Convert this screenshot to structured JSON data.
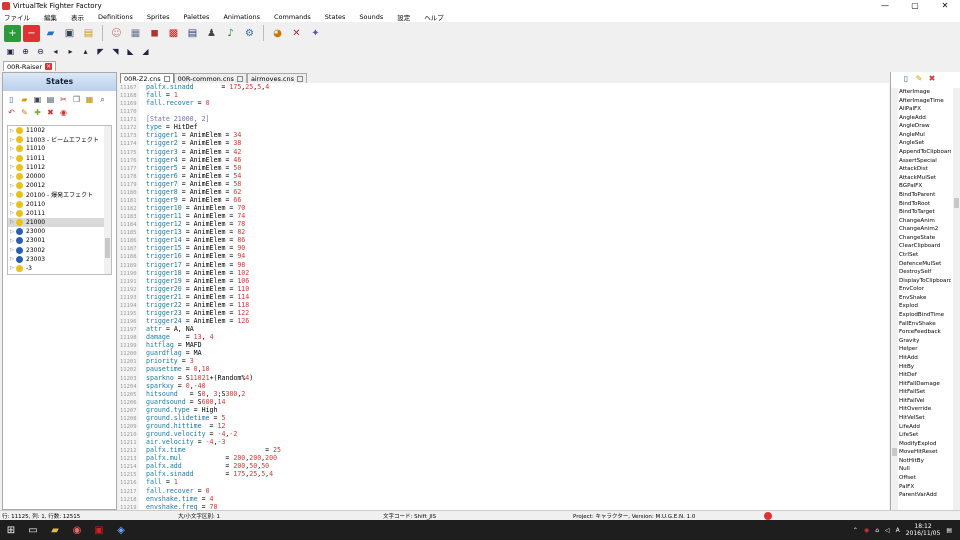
{
  "window": {
    "title": "VirtualTek Fighter Factory",
    "controls": [
      "—",
      "▢",
      "✕"
    ]
  },
  "menu": [
    "ファイル",
    "編集",
    "表示",
    "Definitions",
    "Sprites",
    "Palettes",
    "Animations",
    "Commands",
    "States",
    "Sounds",
    "設定",
    "ヘルプ"
  ],
  "doc_tab": {
    "label": "00R-Raiser"
  },
  "file_tabs": [
    {
      "label": "00R-Z2.cns"
    },
    {
      "label": "00R-common.cns"
    },
    {
      "label": "airmoves.cns"
    }
  ],
  "states_panel": {
    "title": "States",
    "tree": [
      {
        "label": "11002",
        "color": "yellow"
      },
      {
        "label": "11003 - ビームエフェクト",
        "color": "yellow"
      },
      {
        "label": "11010",
        "color": "yellow"
      },
      {
        "label": "11011",
        "color": "yellow"
      },
      {
        "label": "11012",
        "color": "yellow"
      },
      {
        "label": "20000",
        "color": "yellow"
      },
      {
        "label": "20012",
        "color": "yellow"
      },
      {
        "label": "20100 - 爆発エフェクト",
        "color": "yellow"
      },
      {
        "label": "20110",
        "color": "yellow"
      },
      {
        "label": "20111",
        "color": "yellow"
      },
      {
        "label": "21000",
        "color": "yellow",
        "selected": true
      },
      {
        "label": "23000",
        "color": "blue"
      },
      {
        "label": "23001",
        "color": "blue"
      },
      {
        "label": "23002",
        "color": "blue"
      },
      {
        "label": "23003",
        "color": "blue"
      },
      {
        "label": "-3",
        "color": "yellow"
      }
    ]
  },
  "code": {
    "lines": [
      {
        "n": "11167",
        "t": "palfx.sinadd       = 175,25,5,4"
      },
      {
        "n": "11168",
        "t": "fall = 1"
      },
      {
        "n": "11169",
        "t": "fall.recover = 0"
      },
      {
        "n": "11170",
        "t": ""
      },
      {
        "n": "11171",
        "t": "[State 21000, 2]"
      },
      {
        "n": "11172",
        "t": "type = HitDef"
      },
      {
        "n": "11173",
        "t": "trigger1 = AnimElem = 34"
      },
      {
        "n": "11174",
        "t": "trigger2 = AnimElem = 38"
      },
      {
        "n": "11175",
        "t": "trigger3 = AnimElem = 42"
      },
      {
        "n": "11176",
        "t": "trigger4 = AnimElem = 46"
      },
      {
        "n": "11177",
        "t": "trigger5 = AnimElem = 50"
      },
      {
        "n": "11178",
        "t": "trigger6 = AnimElem = 54"
      },
      {
        "n": "11179",
        "t": "trigger7 = AnimElem = 58"
      },
      {
        "n": "11180",
        "t": "trigger8 = AnimElem = 62"
      },
      {
        "n": "11181",
        "t": "trigger9 = AnimElem = 66"
      },
      {
        "n": "11182",
        "t": "trigger10 = AnimElem = 70"
      },
      {
        "n": "11183",
        "t": "trigger11 = AnimElem = 74"
      },
      {
        "n": "11184",
        "t": "trigger12 = AnimElem = 78"
      },
      {
        "n": "11185",
        "t": "trigger13 = AnimElem = 82"
      },
      {
        "n": "11186",
        "t": "trigger14 = AnimElem = 86"
      },
      {
        "n": "11187",
        "t": "trigger15 = AnimElem = 90"
      },
      {
        "n": "11188",
        "t": "trigger16 = AnimElem = 94"
      },
      {
        "n": "11189",
        "t": "trigger17 = AnimElem = 98"
      },
      {
        "n": "11190",
        "t": "trigger18 = AnimElem = 102"
      },
      {
        "n": "11191",
        "t": "trigger19 = AnimElem = 106"
      },
      {
        "n": "11192",
        "t": "trigger20 = AnimElem = 110"
      },
      {
        "n": "11193",
        "t": "trigger21 = AnimElem = 114"
      },
      {
        "n": "11194",
        "t": "trigger22 = AnimElem = 118"
      },
      {
        "n": "11195",
        "t": "trigger23 = AnimElem = 122"
      },
      {
        "n": "11196",
        "t": "trigger24 = AnimElem = 126"
      },
      {
        "n": "11197",
        "t": "attr = A, NA"
      },
      {
        "n": "11198",
        "t": "damage    = 13, 4"
      },
      {
        "n": "11199",
        "t": "hitflag = MAFD"
      },
      {
        "n": "11200",
        "t": "guardflag = MA"
      },
      {
        "n": "11201",
        "t": "priority = 3"
      },
      {
        "n": "11202",
        "t": "pausetime = 0,10"
      },
      {
        "n": "11203",
        "t": "sparkno = S11021+(Random%4)"
      },
      {
        "n": "11204",
        "t": "sparkxy = 0,-40"
      },
      {
        "n": "11205",
        "t": "hitsound   = S0, 3;S300,2"
      },
      {
        "n": "11206",
        "t": "guardsound = S600,14"
      },
      {
        "n": "11207",
        "t": "ground.type = High"
      },
      {
        "n": "11208",
        "t": "ground.slidetime = 5"
      },
      {
        "n": "11209",
        "t": "ground.hittime  = 12"
      },
      {
        "n": "11210",
        "t": "ground.velocity = -4,-2"
      },
      {
        "n": "11211",
        "t": "air.velocity = -4,-3"
      },
      {
        "n": "11212",
        "t": "palfx.time                    = 25"
      },
      {
        "n": "11213",
        "t": "palfx.mul           = 200,200,200"
      },
      {
        "n": "11214",
        "t": "palfx.add           = 200,50,50"
      },
      {
        "n": "11215",
        "t": "palfx.sinadd        = 175,25,5,4"
      },
      {
        "n": "11216",
        "t": "fall = 1"
      },
      {
        "n": "11217",
        "t": "fall.recover = 0"
      },
      {
        "n": "11218",
        "t": "envshake.time = 4"
      },
      {
        "n": "11219",
        "t": "envshake.freq = 70"
      }
    ]
  },
  "sctrl_list": [
    "AfterImage",
    "AfterImageTime",
    "AllPalFX",
    "AngleAdd",
    "AngleDraw",
    "AngleMul",
    "AngleSet",
    "AppendToClipboard",
    "AssertSpecial",
    "AttackDist",
    "AttackMulSet",
    "BGPalFX",
    "BindToParent",
    "BindToRoot",
    "BindToTarget",
    "ChangeAnim",
    "ChangeAnim2",
    "ChangeState",
    "ClearClipboard",
    "CtrlSet",
    "DefenceMulSet",
    "DestroySelf",
    "DisplayToClipboard",
    "EnvColor",
    "EnvShake",
    "Explod",
    "ExplodBindTime",
    "FallEnvShake",
    "ForceFeedback",
    "Gravity",
    "Helper",
    "HitAdd",
    "HitBy",
    "HitDef",
    "HitFallDamage",
    "HitFallSet",
    "HitFallVel",
    "HitOverride",
    "HitVelSet",
    "LifeAdd",
    "LifeSet",
    "ModifyExplod",
    "MoveHitReset",
    "NotHitBy",
    "Null",
    "Offset",
    "PalFX",
    "ParentVarAdd"
  ],
  "status": {
    "pos": "行: 11125, 列: 1, 行数: 12515",
    "case": "大/小文字区別: 1",
    "encoding": "文字コード: Shift_JIS",
    "project": "Project: キャラクター, Version: M.U.G.E.N. 1.0"
  },
  "clock": {
    "time": "18:12",
    "date": "2016/11/05"
  },
  "colors": {
    "keyword": "#1a7aa6",
    "number": "#d33",
    "title_accent": "#d33"
  }
}
